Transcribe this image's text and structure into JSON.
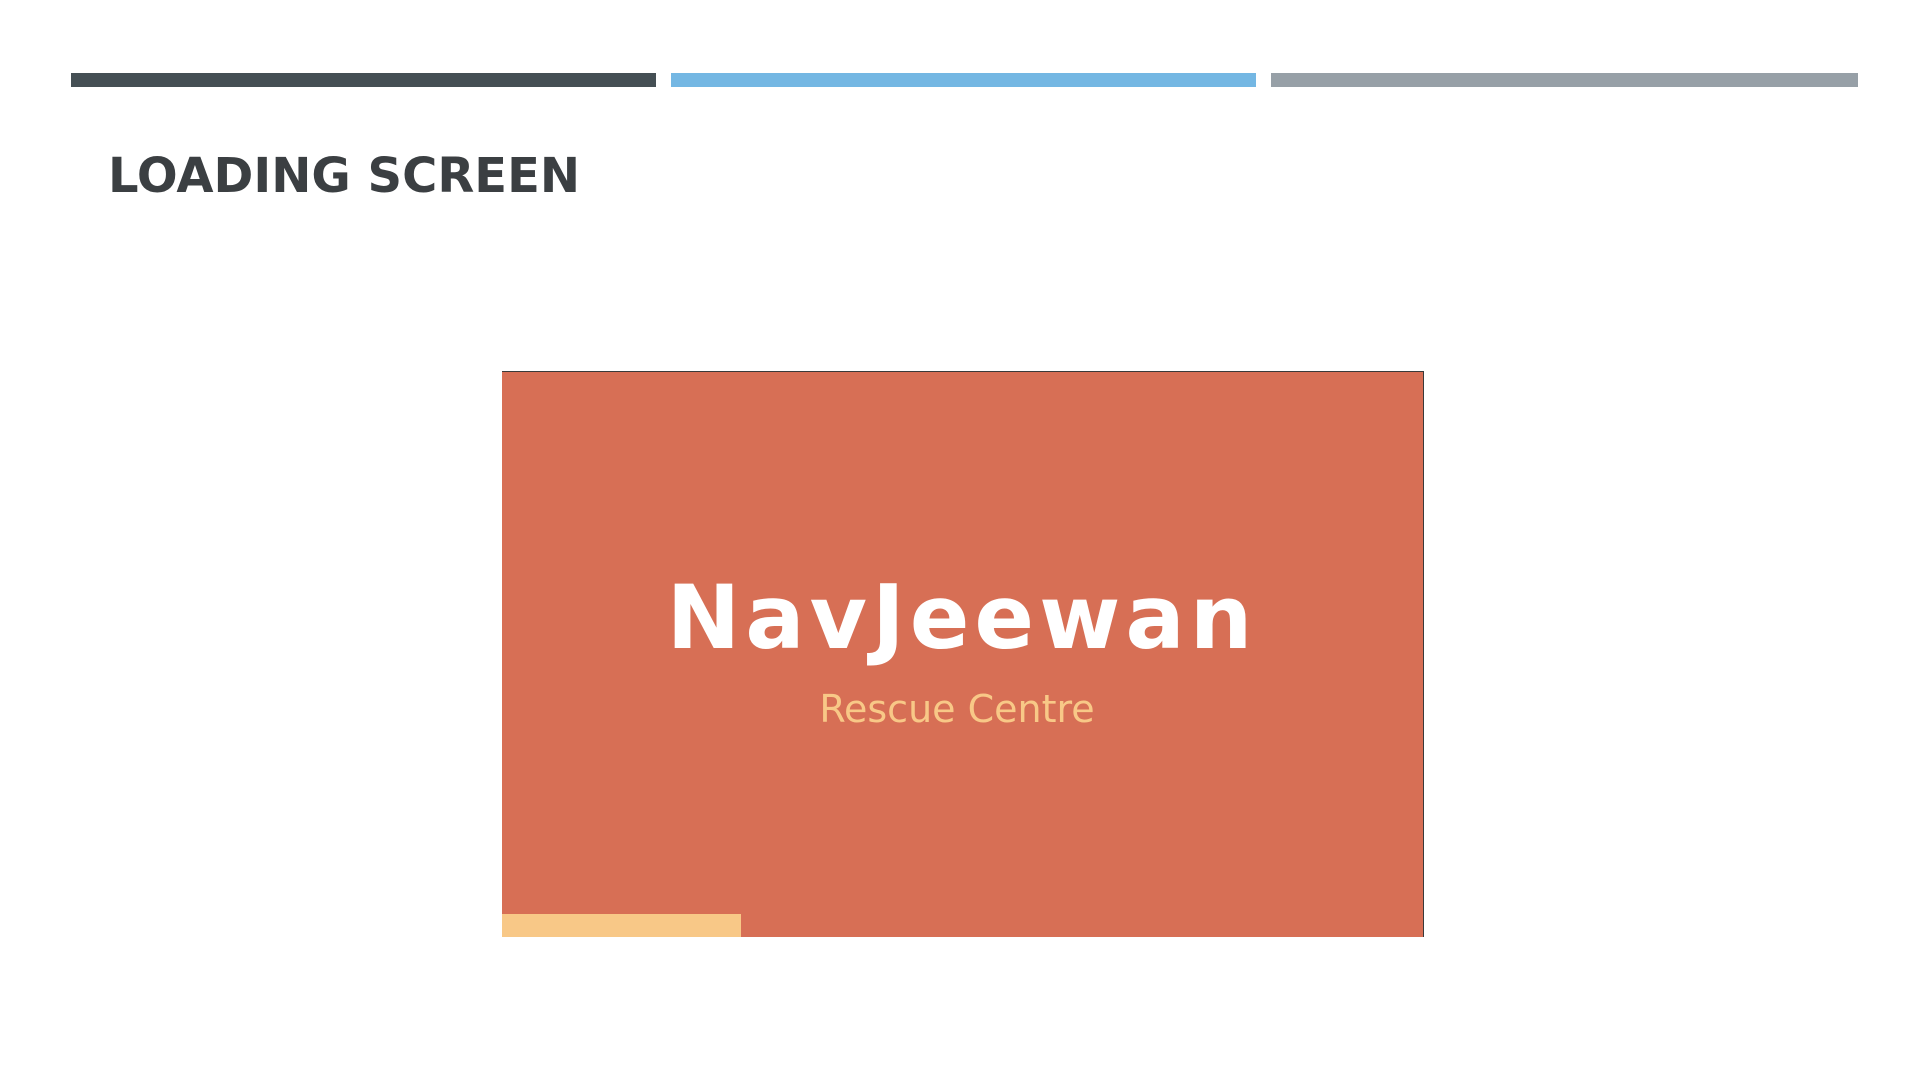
{
  "slide": {
    "title": "LOADING SCREEN"
  },
  "accent_bars": [
    {
      "color": "#454f54"
    },
    {
      "color": "#74b7e3"
    },
    {
      "color": "#97a0a7"
    }
  ],
  "colors": {
    "title": "#3b3f42",
    "screen_background": "#d76f55",
    "app_name": "#ffffff",
    "subtitle": "#f8c887",
    "progress_fill": "#f8c887"
  },
  "loading_screen": {
    "app_name": "NavJeewan",
    "subtitle": "Rescue Centre",
    "progress_fraction": 0.26
  }
}
